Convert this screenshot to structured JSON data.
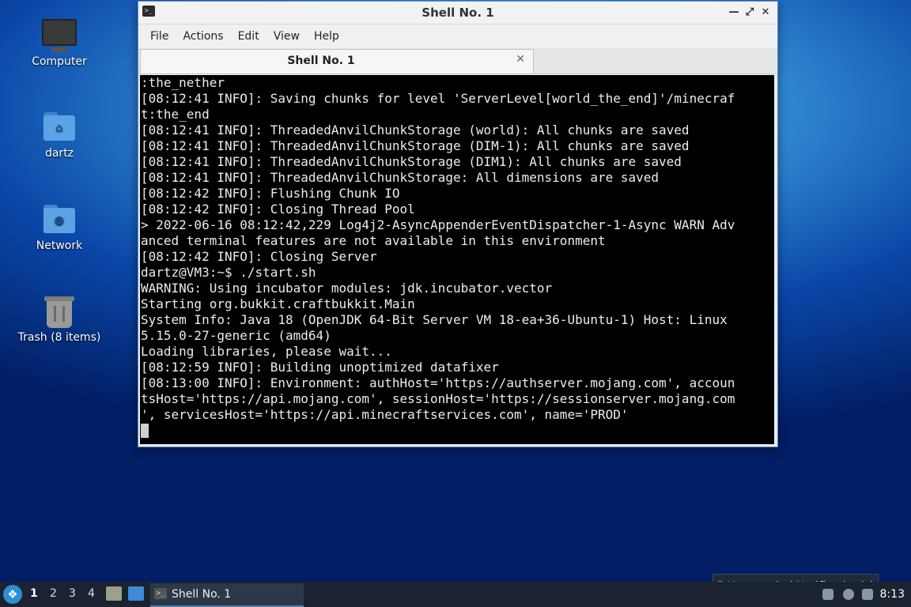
{
  "desktop": {
    "icons": [
      {
        "label": "Computer"
      },
      {
        "label": "dartz"
      },
      {
        "label": "Network"
      },
      {
        "label": "Trash (8 items)"
      }
    ]
  },
  "window": {
    "title": "Shell No. 1",
    "controls": {
      "minimize": "—",
      "maximize": "⤢",
      "close": "✕"
    },
    "menu": [
      "File",
      "Actions",
      "Edit",
      "View",
      "Help"
    ],
    "tab": {
      "label": "Shell No. 1",
      "close": "✕"
    }
  },
  "terminal": {
    "lines": [
      ":the_nether",
      "[08:12:41 INFO]: Saving chunks for level 'ServerLevel[world_the_end]'/minecraf",
      "t:the_end",
      "[08:12:41 INFO]: ThreadedAnvilChunkStorage (world): All chunks are saved",
      "[08:12:41 INFO]: ThreadedAnvilChunkStorage (DIM-1): All chunks are saved",
      "[08:12:41 INFO]: ThreadedAnvilChunkStorage (DIM1): All chunks are saved",
      "[08:12:41 INFO]: ThreadedAnvilChunkStorage: All dimensions are saved",
      "[08:12:42 INFO]: Flushing Chunk IO",
      "[08:12:42 INFO]: Closing Thread Pool",
      "> 2022-06-16 08:12:42,229 Log4j2-AsyncAppenderEventDispatcher-1-Async WARN Adv",
      "anced terminal features are not available in this environment",
      "[08:12:42 INFO]: Closing Server",
      "dartz@VM3:~$ ./start.sh",
      "WARNING: Using incubator modules: jdk.incubator.vector",
      "Starting org.bukkit.craftbukkit.Main",
      "System Info: Java 18 (OpenJDK 64-Bit Server VM 18-ea+36-Ubuntu-1) Host: Linux",
      "5.15.0-27-generic (amd64)",
      "Loading libraries, please wait...",
      "[08:12:59 INFO]: Building unoptimized datafixer",
      "[08:13:00 INFO]: Environment: authHost='https://authserver.mojang.com', accoun",
      "tsHost='https://api.mojang.com', sessionHost='https://sessionserver.mojang.com",
      "', servicesHost='https://api.minecraftservices.com', name='PROD'"
    ]
  },
  "taskbar": {
    "workspaces": [
      "1",
      "2",
      "3",
      "4"
    ],
    "active_task": "Shell No. 1",
    "clock": "8:13"
  },
  "notification": {
    "text": "5 Unattended Notification(s)"
  }
}
